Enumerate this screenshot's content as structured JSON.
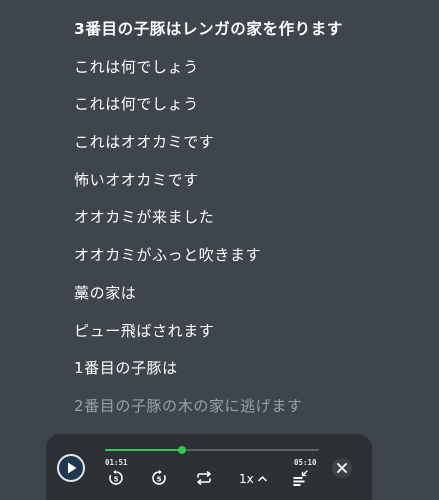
{
  "lyrics": {
    "lines": [
      {
        "text": "3番目の子豚はレンガの家を作ります",
        "state": "current"
      },
      {
        "text": "これは何でしょう",
        "state": "normal"
      },
      {
        "text": "これは何でしょう",
        "state": "normal"
      },
      {
        "text": "これはオオカミです",
        "state": "normal"
      },
      {
        "text": "怖いオオカミです",
        "state": "normal"
      },
      {
        "text": "オオカミが来ました",
        "state": "normal"
      },
      {
        "text": "オオカミがふっと吹きます",
        "state": "normal"
      },
      {
        "text": "藁の家は",
        "state": "normal"
      },
      {
        "text": "ピュー飛ばされます",
        "state": "normal"
      },
      {
        "text": "1番目の子豚は",
        "state": "normal"
      },
      {
        "text": "2番目の子豚の木の家に逃げます",
        "state": "upcoming"
      }
    ]
  },
  "player": {
    "elapsed": "01:51",
    "total": "05:10",
    "progress_fraction": 0.358,
    "speed": "1x",
    "progress_color": "#2fc853",
    "icons": {
      "play": "play-icon",
      "rewind": "rewind-5-icon",
      "forward": "forward-5-icon",
      "repeat": "repeat-icon",
      "speed_caret": "chevron-up-icon",
      "subtitles": "subtitles-collapse-icon",
      "close": "close-icon"
    }
  }
}
